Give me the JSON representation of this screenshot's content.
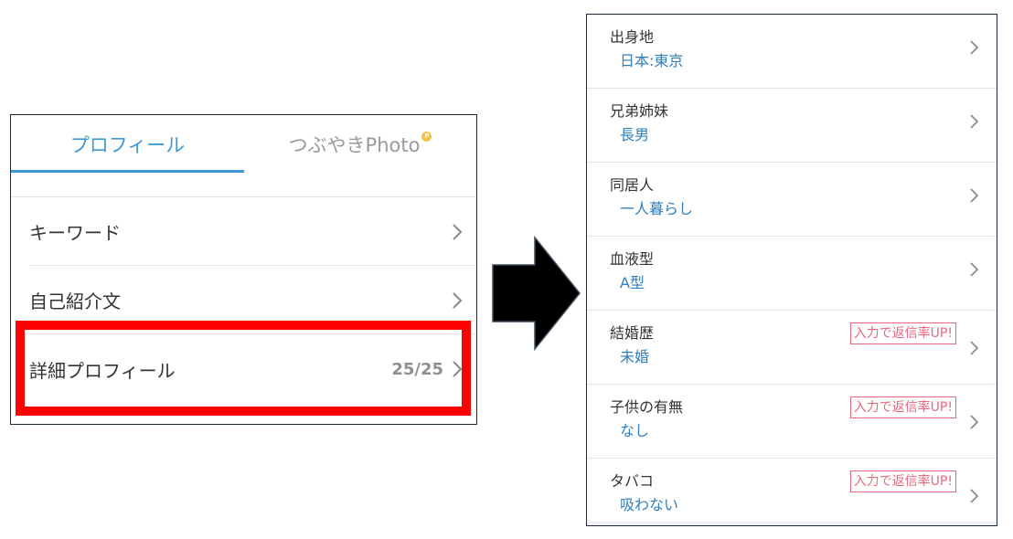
{
  "left": {
    "tabs": {
      "profile": "プロフィール",
      "photo": "つぶやきPhoto",
      "coin_glyph": "P"
    },
    "menu": {
      "keyword": "キーワード",
      "intro": "自己紹介文",
      "detail": "詳細プロフィール",
      "detail_count": "25/25"
    }
  },
  "right": {
    "rows": [
      {
        "label": "出身地",
        "value": "日本:東京",
        "badge": ""
      },
      {
        "label": "兄弟姉妹",
        "value": "長男",
        "badge": ""
      },
      {
        "label": "同居人",
        "value": "一人暮らし",
        "badge": ""
      },
      {
        "label": "血液型",
        "value": "A型",
        "badge": ""
      },
      {
        "label": "結婚歴",
        "value": "未婚",
        "badge": "入力で返信率UP!"
      },
      {
        "label": "子供の有無",
        "value": "なし",
        "badge": "入力で返信率UP!"
      },
      {
        "label": "タバコ",
        "value": "吸わない",
        "badge": "入力で返信率UP!"
      }
    ]
  },
  "colors": {
    "accent": "#3d9ad6",
    "value_text": "#2e7fbf",
    "highlight": "#ff0000",
    "badge": "#e8677f"
  },
  "icons": {
    "chevron": "chevron-right-icon",
    "coin": "coin-icon",
    "arrow": "arrow-right-icon"
  }
}
